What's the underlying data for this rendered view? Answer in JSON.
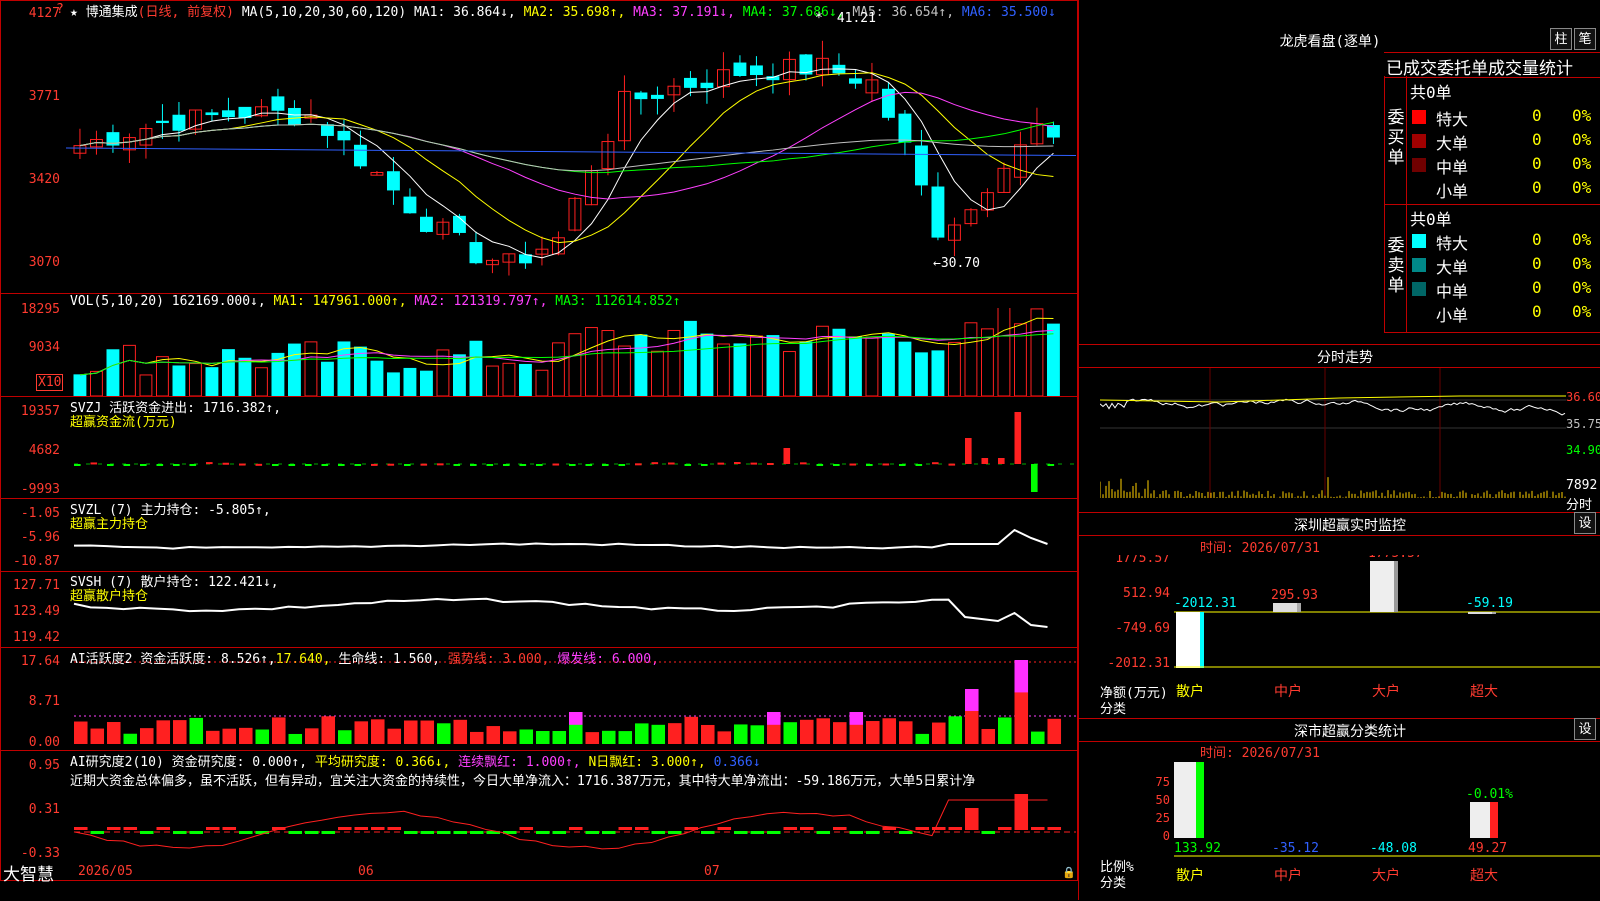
{
  "stock": {
    "star": "★",
    "name": "博通集成",
    "mode": "(日线, 前复权)",
    "ma_label": "MA(5,10,20,30,60,120)"
  },
  "ma_values": [
    {
      "label": "MA1: 36.864↓,",
      "color": "#ffffff"
    },
    {
      "label": "MA2: 35.698↑,",
      "color": "#ffff00"
    },
    {
      "label": "MA3: 37.191↓,",
      "color": "#ff40ff"
    },
    {
      "label": "MA4: 37.686↓,",
      "color": "#00ff00"
    },
    {
      "label": "MA5: 36.654↑,",
      "color": "#c0c0c0"
    },
    {
      "label": "MA6: 35.500↓",
      "color": "#3060ff"
    }
  ],
  "price_axis": [
    "4127",
    "3771",
    "3420",
    "3070"
  ],
  "price_marks": {
    "high": "41.21",
    "low": "←30.70"
  },
  "vol": {
    "header": "VOL(5,10,20)",
    "value": "162169.000↓,",
    "ma1": "MA1: 147961.000↑,",
    "ma2": "MA2: 121319.797↑,",
    "ma3": "MA3: 112614.852↑",
    "axis": [
      "18295",
      "9034"
    ],
    "unit": "X10"
  },
  "svzj": {
    "title": "SVZJ  活跃资金进出: 1716.382↑,",
    "sub": "超赢资金流(万元)",
    "axis": [
      "19357",
      "4682",
      "-9993"
    ]
  },
  "svzl": {
    "title": "SVZL (7) 主力持仓: -5.805↑,",
    "sub": "超赢主力持仓",
    "axis": [
      "-1.05",
      "-5.96",
      "-10.87"
    ]
  },
  "svsh": {
    "title": "SVSH (7) 散户持仓: 122.421↓,",
    "sub": "超赢散户持仓",
    "axis": [
      "127.71",
      "123.49",
      "119.42"
    ]
  },
  "ai1": {
    "p1": "AI活跃度2 资金活跃度: 8.526↑,",
    "p2": "17.640,",
    "p3": "生命线: 1.560,",
    "p4": "强势线: 3.000,",
    "p5": "爆发线: 6.000,",
    "axis": [
      "17.64",
      "8.71",
      "0.00"
    ]
  },
  "ai2": {
    "p1": "AI研究度2(10) 资金研究度: 0.000↑,",
    "p2": "平均研究度: 0.366↓,",
    "p3": "连续飘红: 1.000↑,",
    "p4": "N日飘红: 3.000↑,",
    "p5": "0.366↓",
    "axis": [
      "0.95",
      "0.31",
      "-0.33"
    ],
    "comment": "近期大资金总体偏多，虽不活跃，但有异动，宜关注大资金的持续性，今日大单净流入：1716.387万元，其中特大单净流出：-59.186万元，大单5日累计净"
  },
  "bottom": {
    "brand": "大智慧",
    "dates": [
      "2026/05",
      "06",
      "07"
    ]
  },
  "lhb": {
    "title": "龙虎看盘(逐单)",
    "btn1": "柱",
    "btn2": "笔",
    "tabs": "已成交委托单成交量统计",
    "buy_label": "委买单",
    "sell_label": "委卖单",
    "buy_total": "共0单",
    "sell_total": "共0单",
    "buy_rows": [
      {
        "name": "特大",
        "n": "0",
        "p": "0%",
        "color": "#ff0000"
      },
      {
        "name": "大单",
        "n": "0",
        "p": "0%",
        "color": "#a00000"
      },
      {
        "name": "中单",
        "n": "0",
        "p": "0%",
        "color": "#700000"
      },
      {
        "name": "小单",
        "n": "0",
        "p": "0%",
        "color": ""
      }
    ],
    "sell_rows": [
      {
        "name": "特大",
        "n": "0",
        "p": "0%",
        "color": "#00ffff"
      },
      {
        "name": "大单",
        "n": "0",
        "p": "0%",
        "color": "#008888"
      },
      {
        "name": "中单",
        "n": "0",
        "p": "0%",
        "color": "#006666"
      },
      {
        "name": "小单",
        "n": "0",
        "p": "0%",
        "color": ""
      }
    ]
  },
  "fenshi": {
    "title": "分时走势",
    "axis": [
      "36.60",
      "35.75",
      "34.90"
    ],
    "vol_label": "7892",
    "unit": "分时"
  },
  "monitor": {
    "title": "深圳超赢实时监控",
    "btn": "设",
    "time": "时间: 2026/07/31",
    "axis": [
      "1775.57",
      "512.94",
      "-749.69",
      "-2012.31"
    ],
    "y_title": "净额(万元)",
    "x_title": "分类",
    "categories": [
      "散户",
      "中户",
      "大户",
      "超大"
    ],
    "values": [
      "-2012.31",
      "295.93",
      "1775.57",
      "-59.19"
    ]
  },
  "classify": {
    "title": "深市超赢分类统计",
    "btn": "设",
    "time": "时间: 2026/07/31",
    "axis": [
      "75",
      "50",
      "25",
      "0"
    ],
    "y_title": "比例%",
    "x_title": "分类",
    "categories": [
      "散户",
      "中户",
      "大户",
      "超大"
    ],
    "values": [
      "133.92",
      "-35.12",
      "-48.08",
      "49.27"
    ],
    "top_label": "-0.01%"
  }
}
